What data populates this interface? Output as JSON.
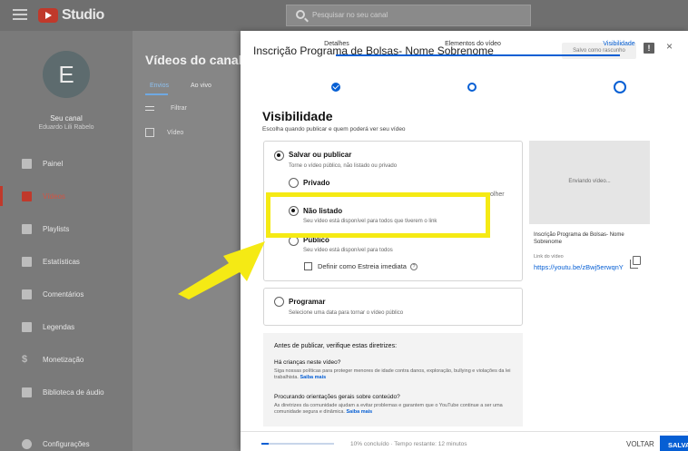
{
  "topbar": {
    "logo_text": "Studio",
    "search_placeholder": "Pesquisar no seu canal"
  },
  "sidebar": {
    "avatar_letter": "E",
    "channel_name": "Seu canal",
    "channel_sub": "Eduardo Lili Rabelo",
    "items": [
      {
        "label": "Painel",
        "icon": "dashboard-icon"
      },
      {
        "label": "Vídeos",
        "icon": "videos-icon",
        "active": true
      },
      {
        "label": "Playlists",
        "icon": "playlists-icon"
      },
      {
        "label": "Estatísticas",
        "icon": "analytics-icon"
      },
      {
        "label": "Comentários",
        "icon": "comments-icon"
      },
      {
        "label": "Legendas",
        "icon": "subtitles-icon"
      },
      {
        "label": "Monetização",
        "icon": "monetization-icon"
      },
      {
        "label": "Biblioteca de áudio",
        "icon": "audio-library-icon"
      },
      {
        "label": "Configurações",
        "icon": "settings-icon"
      }
    ]
  },
  "content": {
    "title": "Vídeos do canal",
    "tabs": [
      "Envios",
      "Ao vivo"
    ],
    "filter_label": "Filtrar",
    "column_label": "Vídeo"
  },
  "modal": {
    "title": "Inscrição Programa de Bolsas- Nome Sobrenome",
    "saved_label": "Salvo como rascunho",
    "feedback_glyph": "!",
    "close_glyph": "×",
    "steps": [
      "Detalhes",
      "Elementos do vídeo",
      "Visibilidade"
    ],
    "section_title": "Visibilidade",
    "section_subtitle": "Escolha quando publicar e quem poderá ver seu vídeo",
    "save_publish": {
      "label": "Salvar ou publicar",
      "desc": "Torne o vídeo público, não listado ou privado",
      "options": [
        {
          "label": "Privado",
          "desc": ""
        },
        {
          "label": "Não listado",
          "desc": "Seu vídeo está disponível para todos que tiverem o link"
        },
        {
          "label": "Público",
          "desc": "Seu vídeo está disponível para todos"
        }
      ],
      "premiere_label": "Definir como Estreia imediata",
      "help_glyph": "?",
      "partial_text": "olher"
    },
    "schedule": {
      "label": "Programar",
      "desc": "Selecione uma data para tornar o vídeo público"
    },
    "preview": {
      "status": "Enviando vídeo...",
      "video_title": "Inscrição Programa de Bolsas- Nome Sobrenome",
      "link_label": "Link do vídeo",
      "link_url": "https://youtu.be/zBwj5erwqnY"
    },
    "guidelines": {
      "title": "Antes de publicar, verifique estas diretrizes:",
      "q1": "Há crianças neste vídeo?",
      "t1": "Siga nossas políticas para proteger menores de idade contra danos, exploração, bullying e violações da lei trabalhista.",
      "q2": "Procurando orientações gerais sobre conteúdo?",
      "t2": "As diretrizes da comunidade ajudam a evitar problemas e garantem que o YouTube continue a ser uma comunidade segura e dinâmica.",
      "link_text": "Saiba mais"
    },
    "footer": {
      "progress_percent": 10,
      "progress_text": "10% concluído · Tempo restante: 12 minutos",
      "back_label": "VOLTAR",
      "save_label": "SALVAR"
    }
  },
  "colors": {
    "accent": "#065fd4",
    "brand_red": "#c0392b",
    "highlight_yellow": "#f5ea14"
  }
}
